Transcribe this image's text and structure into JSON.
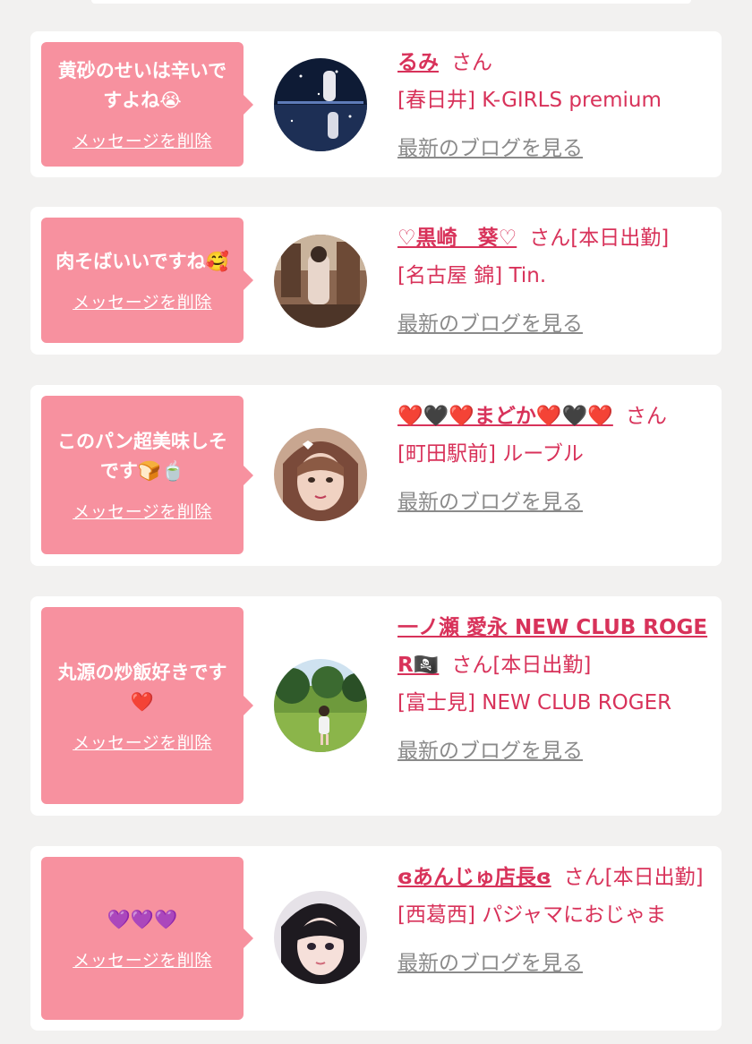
{
  "common": {
    "delete_label": "メッセージを削除",
    "blog_label": "最新のブログを見る",
    "san": "さん"
  },
  "cards": [
    {
      "message": "黄砂のせいは辛いですよね😭",
      "name": "るみ",
      "tag": "",
      "shop": "[春日井] K-GIRLS premium"
    },
    {
      "message": "肉そばいいですね🥰",
      "name": "♡黒崎　葵♡",
      "tag": "[本日出勤]",
      "shop": "[名古屋 錦] Tin."
    },
    {
      "message": "このパン超美味しそです🍞🍵",
      "name": "❤️🖤❤️まどか❤️🖤❤️",
      "tag": "",
      "shop": "[町田駅前] ルーブル"
    },
    {
      "message": "丸源の炒飯好きです❤️",
      "name": "一ノ瀬 愛永 NEW CLUB ROGER🏴‍☠️",
      "tag": "[本日出勤]",
      "shop": "[富士見] NEW CLUB ROGER"
    },
    {
      "message": "💜💜💜",
      "name": "ɞあんじゅ店長ɞ",
      "tag": "[本日出勤]",
      "shop": "[西葛西] パジャマにおじゃま"
    }
  ],
  "colors": {
    "accent": "#d8325a",
    "bubble": "#f7919f",
    "background": "#f2f1f0",
    "link_gray": "#8a8a8a"
  }
}
